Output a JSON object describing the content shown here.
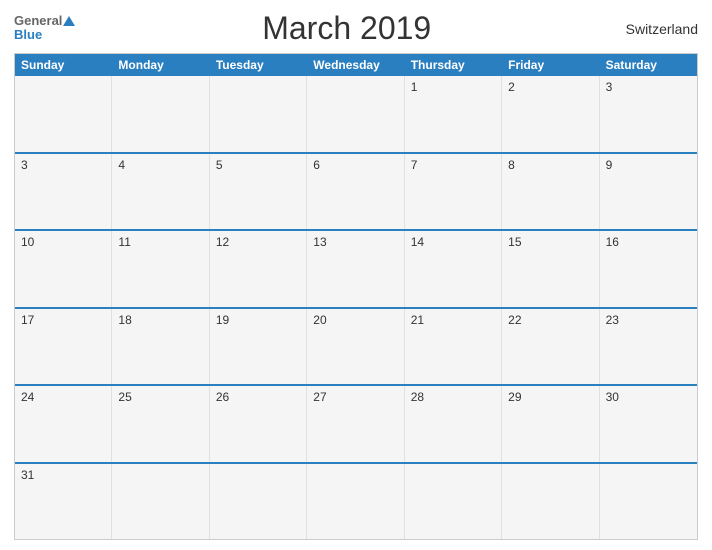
{
  "header": {
    "logo_general": "General",
    "logo_blue": "Blue",
    "title": "March 2019",
    "country": "Switzerland"
  },
  "calendar": {
    "day_headers": [
      "Sunday",
      "Monday",
      "Tuesday",
      "Wednesday",
      "Thursday",
      "Friday",
      "Saturday"
    ],
    "weeks": [
      [
        "",
        "",
        "",
        "",
        "1",
        "2",
        "3"
      ],
      [
        "3",
        "4",
        "5",
        "6",
        "7",
        "8",
        "9"
      ],
      [
        "10",
        "11",
        "12",
        "13",
        "14",
        "15",
        "16"
      ],
      [
        "17",
        "18",
        "19",
        "20",
        "21",
        "22",
        "23"
      ],
      [
        "24",
        "25",
        "26",
        "27",
        "28",
        "29",
        "30"
      ],
      [
        "31",
        "",
        "",
        "",
        "",
        "",
        ""
      ]
    ]
  }
}
